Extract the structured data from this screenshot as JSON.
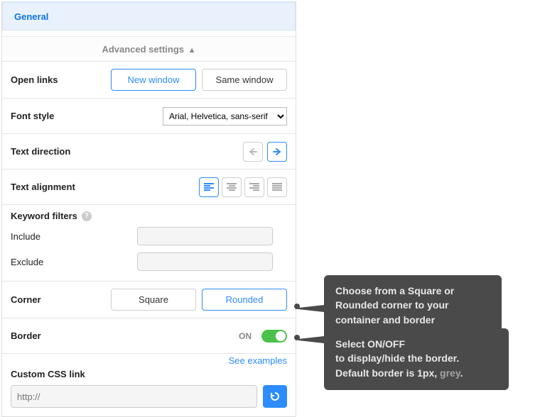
{
  "tab": {
    "label": "General"
  },
  "advanced": {
    "label": "Advanced settings"
  },
  "openLinks": {
    "label": "Open links",
    "newWindow": "New window",
    "sameWindow": "Same window",
    "active": "new"
  },
  "fontStyle": {
    "label": "Font style",
    "value": "Arial, Helvetica, sans-serif"
  },
  "textDirection": {
    "label": "Text direction",
    "active": "rtl"
  },
  "textAlignment": {
    "label": "Text alignment",
    "active": "left"
  },
  "keywordFilters": {
    "title": "Keyword filters",
    "include": "Include",
    "exclude": "Exclude"
  },
  "corner": {
    "label": "Corner",
    "square": "Square",
    "rounded": "Rounded",
    "active": "rounded"
  },
  "border": {
    "label": "Border",
    "on": "ON",
    "state": true
  },
  "customCss": {
    "title": "Custom CSS link",
    "seeExamples": "See examples",
    "placeholder": "http://"
  },
  "callout1": {
    "line1": "Choose from a Square or",
    "line2": "Rounded corner to your",
    "line3": "container and border"
  },
  "callout2": {
    "line1": "Select ON/OFF",
    "line2": "to display/hide the border.",
    "line3a": "Default border is 1px, ",
    "line3b": "grey",
    "line3c": "."
  }
}
